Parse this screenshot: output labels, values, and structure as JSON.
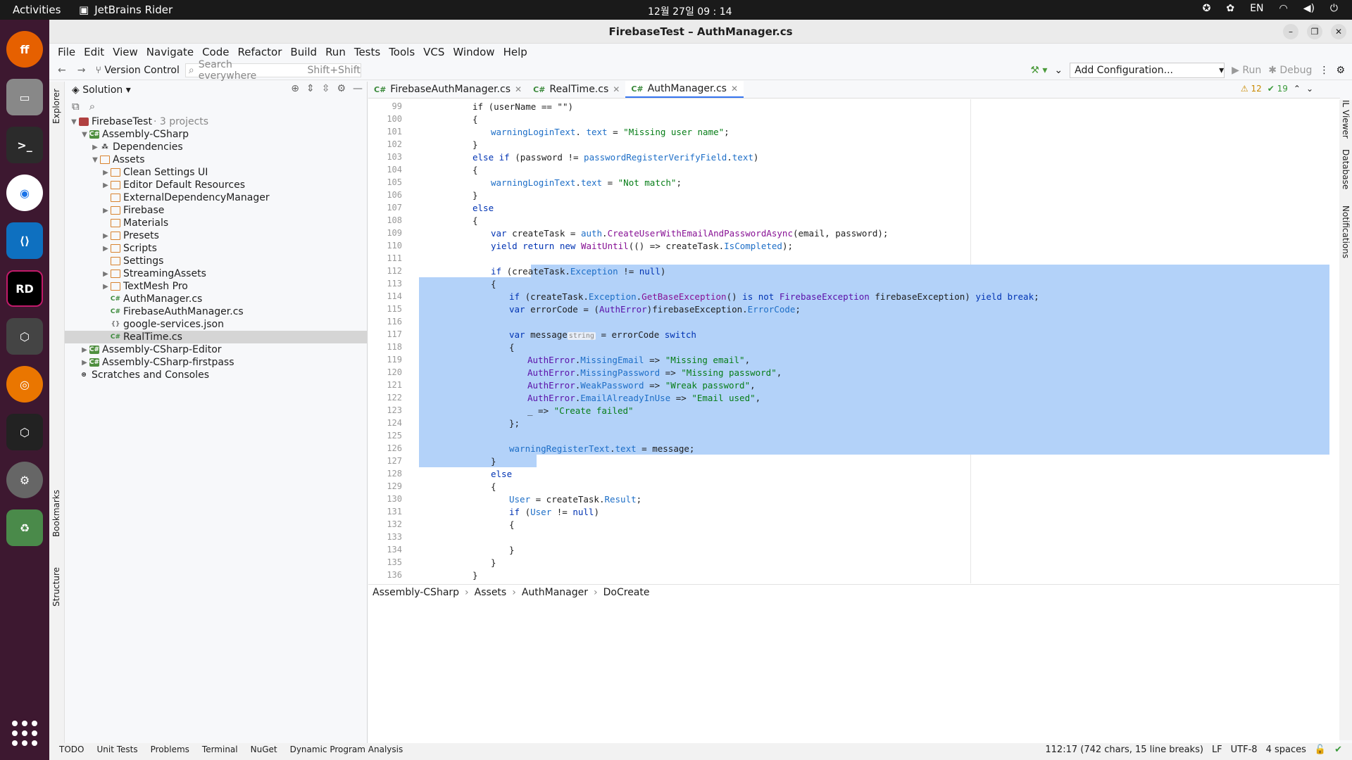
{
  "os": {
    "activities": "Activities",
    "app_name": "JetBrains Rider",
    "clock": "12월 27일  09 : 14",
    "lang": "EN"
  },
  "window": {
    "title": "FirebaseTest – AuthManager.cs"
  },
  "menu": [
    "File",
    "Edit",
    "View",
    "Navigate",
    "Code",
    "Refactor",
    "Build",
    "Run",
    "Tests",
    "Tools",
    "VCS",
    "Window",
    "Help"
  ],
  "toolbar": {
    "version_control": "Version Control",
    "search_placeholder": "Search everywhere",
    "search_shortcut": "Shift+Shift",
    "add_config": "Add Configuration...",
    "run": "Run",
    "debug": "Debug"
  },
  "explorer": {
    "title": "Solution",
    "left_label": "Explorer",
    "bookmarks": "Bookmarks",
    "structure": "Structure",
    "tree": [
      {
        "label": "FirebaseTest",
        "muted": "· 3 projects",
        "indent": 0,
        "arrow": "▼",
        "icon": "sol"
      },
      {
        "label": "Assembly-CSharp",
        "indent": 1,
        "arrow": "▼",
        "icon": "proj"
      },
      {
        "label": "Dependencies",
        "indent": 2,
        "arrow": "▶",
        "icon": "dep"
      },
      {
        "label": "Assets",
        "indent": 2,
        "arrow": "▼",
        "icon": "folder"
      },
      {
        "label": "Clean Settings UI",
        "indent": 3,
        "arrow": "▶",
        "icon": "folder"
      },
      {
        "label": "Editor Default Resources",
        "indent": 3,
        "arrow": "▶",
        "icon": "folder"
      },
      {
        "label": "ExternalDependencyManager",
        "indent": 3,
        "arrow": "",
        "icon": "folder"
      },
      {
        "label": "Firebase",
        "indent": 3,
        "arrow": "▶",
        "icon": "folder"
      },
      {
        "label": "Materials",
        "indent": 3,
        "arrow": "",
        "icon": "folder"
      },
      {
        "label": "Presets",
        "indent": 3,
        "arrow": "▶",
        "icon": "folder"
      },
      {
        "label": "Scripts",
        "indent": 3,
        "arrow": "▶",
        "icon": "folder"
      },
      {
        "label": "Settings",
        "indent": 3,
        "arrow": "",
        "icon": "folder"
      },
      {
        "label": "StreamingAssets",
        "indent": 3,
        "arrow": "▶",
        "icon": "folder"
      },
      {
        "label": "TextMesh Pro",
        "indent": 3,
        "arrow": "▶",
        "icon": "folder"
      },
      {
        "label": "AuthManager.cs",
        "indent": 3,
        "arrow": "",
        "icon": "cs"
      },
      {
        "label": "FirebaseAuthManager.cs",
        "indent": 3,
        "arrow": "",
        "icon": "cs"
      },
      {
        "label": "google-services.json",
        "indent": 3,
        "arrow": "",
        "icon": "json"
      },
      {
        "label": "RealTime.cs",
        "indent": 3,
        "arrow": "",
        "icon": "cs",
        "selected": true
      },
      {
        "label": "Assembly-CSharp-Editor",
        "indent": 1,
        "arrow": "▶",
        "icon": "proj"
      },
      {
        "label": "Assembly-CSharp-firstpass",
        "indent": 1,
        "arrow": "▶",
        "icon": "proj"
      },
      {
        "label": "Scratches and Consoles",
        "indent": 0,
        "arrow": "",
        "icon": "scratch"
      }
    ]
  },
  "tabs": [
    {
      "label": "FirebaseAuthManager.cs",
      "active": false
    },
    {
      "label": "RealTime.cs",
      "active": false
    },
    {
      "label": "AuthManager.cs",
      "active": true
    }
  ],
  "indicators": {
    "warnings": "12",
    "ok": "19"
  },
  "right_labels": [
    "IL Viewer",
    "Database",
    "Notifications"
  ],
  "code": {
    "first_line": 99,
    "selection": [
      112,
      127
    ],
    "lines": [
      [
        [
          "",
          "if ("
        ],
        [
          "",
          "userName == \"\")"
        ]
      ],
      [
        [
          "",
          "{"
        ]
      ],
      [
        [
          "fld",
          "warningLoginText"
        ],
        [
          "",
          ". "
        ],
        [
          "fld",
          "text"
        ],
        [
          "",
          " = "
        ],
        [
          "str",
          "\"Missing user name\""
        ],
        [
          "",
          ";"
        ]
      ],
      [
        [
          "",
          "}"
        ]
      ],
      [
        [
          "kw",
          "else if"
        ],
        [
          "",
          " (password != "
        ],
        [
          "fld",
          "passwordRegisterVerifyField"
        ],
        [
          "",
          "."
        ],
        [
          "fld",
          "text"
        ],
        [
          "",
          ")"
        ]
      ],
      [
        [
          "",
          "{"
        ]
      ],
      [
        [
          "fld",
          "warningLoginText"
        ],
        [
          "",
          "."
        ],
        [
          "fld",
          "text"
        ],
        [
          "",
          " = "
        ],
        [
          "str",
          "\"Not match\""
        ],
        [
          "",
          ";"
        ]
      ],
      [
        [
          "",
          "}"
        ]
      ],
      [
        [
          "kw",
          "else"
        ]
      ],
      [
        [
          "",
          "{"
        ]
      ],
      [
        [
          "kw",
          "var"
        ],
        [
          "",
          " createTask = "
        ],
        [
          "fld",
          "auth"
        ],
        [
          "",
          "."
        ],
        [
          "mem",
          "CreateUserWithEmailAndPasswordAsync"
        ],
        [
          "",
          "(email, password);"
        ]
      ],
      [
        [
          "kw",
          "yield return new"
        ],
        [
          "",
          " "
        ],
        [
          "mem",
          "WaitUntil"
        ],
        [
          "",
          "(() => createTask."
        ],
        [
          "fld",
          "IsCompleted"
        ],
        [
          "",
          ");"
        ]
      ],
      [],
      [
        [
          "kw",
          "if"
        ],
        [
          "",
          " (createTask."
        ],
        [
          "fld",
          "Exception"
        ],
        [
          "",
          " != "
        ],
        [
          "kw",
          "null"
        ],
        [
          "",
          ")"
        ]
      ],
      [
        [
          "",
          "{"
        ]
      ],
      [
        [
          "kw",
          "if"
        ],
        [
          "",
          " (createTask."
        ],
        [
          "fld",
          "Exception"
        ],
        [
          "",
          "."
        ],
        [
          "mem",
          "GetBaseException"
        ],
        [
          "",
          "() "
        ],
        [
          "kw",
          "is not"
        ],
        [
          "",
          " "
        ],
        [
          "typ",
          "FirebaseException"
        ],
        [
          "",
          " firebaseException) "
        ],
        [
          "kw",
          "yield break"
        ],
        [
          "",
          ";"
        ]
      ],
      [
        [
          "kw",
          "var"
        ],
        [
          "",
          " errorCode = ("
        ],
        [
          "typ",
          "AuthError"
        ],
        [
          "",
          ")firebaseException."
        ],
        [
          "fld",
          "ErrorCode"
        ],
        [
          "",
          ";"
        ]
      ],
      [],
      [
        [
          "kw",
          "var"
        ],
        [
          "",
          " message"
        ],
        [
          "hint",
          "string"
        ],
        [
          "",
          " = errorCode "
        ],
        [
          "kw",
          "switch"
        ]
      ],
      [
        [
          "",
          "{"
        ]
      ],
      [
        [
          "typ",
          "AuthError"
        ],
        [
          "",
          "."
        ],
        [
          "fld",
          "MissingEmail"
        ],
        [
          "",
          " => "
        ],
        [
          "str",
          "\"Missing email\""
        ],
        [
          "",
          ","
        ]
      ],
      [
        [
          "typ",
          "AuthError"
        ],
        [
          "",
          "."
        ],
        [
          "fld",
          "MissingPassword"
        ],
        [
          "",
          " => "
        ],
        [
          "str",
          "\"Missing password\""
        ],
        [
          "",
          ","
        ]
      ],
      [
        [
          "typ",
          "AuthError"
        ],
        [
          "",
          "."
        ],
        [
          "fld",
          "WeakPassword"
        ],
        [
          "",
          " => "
        ],
        [
          "str",
          "\"Wreak password\""
        ],
        [
          "",
          ","
        ]
      ],
      [
        [
          "typ",
          "AuthError"
        ],
        [
          "",
          "."
        ],
        [
          "fld",
          "EmailAlreadyInUse"
        ],
        [
          "",
          " => "
        ],
        [
          "str",
          "\"Email used\""
        ],
        [
          "",
          ","
        ]
      ],
      [
        [
          "",
          "_ => "
        ],
        [
          "str",
          "\"Create failed\""
        ]
      ],
      [
        [
          "",
          "};"
        ]
      ],
      [],
      [
        [
          "fld",
          "warningRegisterText"
        ],
        [
          "",
          "."
        ],
        [
          "fld",
          "text"
        ],
        [
          "",
          " = message;"
        ]
      ],
      [
        [
          "",
          "}"
        ]
      ],
      [
        [
          "kw",
          "else"
        ]
      ],
      [
        [
          "",
          "{"
        ]
      ],
      [
        [
          "fld",
          "User"
        ],
        [
          "",
          " = createTask."
        ],
        [
          "fld",
          "Result"
        ],
        [
          "",
          ";"
        ]
      ],
      [
        [
          "kw",
          "if"
        ],
        [
          "",
          " ("
        ],
        [
          "fld",
          "User"
        ],
        [
          "",
          " != "
        ],
        [
          "kw",
          "null"
        ],
        [
          "",
          ")"
        ]
      ],
      [
        [
          "",
          "{"
        ]
      ],
      [],
      [
        [
          "",
          "}"
        ]
      ],
      [
        [
          "",
          "}"
        ]
      ],
      [
        [
          "",
          "}"
        ]
      ],
      [
        [
          "",
          "}"
        ]
      ]
    ],
    "indent": [
      3,
      3,
      4,
      3,
      3,
      3,
      4,
      3,
      3,
      3,
      4,
      4,
      0,
      4,
      4,
      5,
      5,
      0,
      5,
      5,
      6,
      6,
      6,
      6,
      6,
      5,
      0,
      5,
      4,
      4,
      4,
      5,
      5,
      5,
      0,
      5,
      4,
      3,
      2
    ]
  },
  "breadcrumb": [
    "Assembly-CSharp",
    "Assets",
    "AuthManager",
    "DoCreate"
  ],
  "bottom_tools": [
    "TODO",
    "Unit Tests",
    "Problems",
    "Terminal",
    "NuGet",
    "Dynamic Program Analysis"
  ],
  "status": {
    "position": "112:17 (742 chars, 15 line breaks)",
    "line_ending": "LF",
    "encoding": "UTF-8",
    "indent": "4 spaces"
  }
}
